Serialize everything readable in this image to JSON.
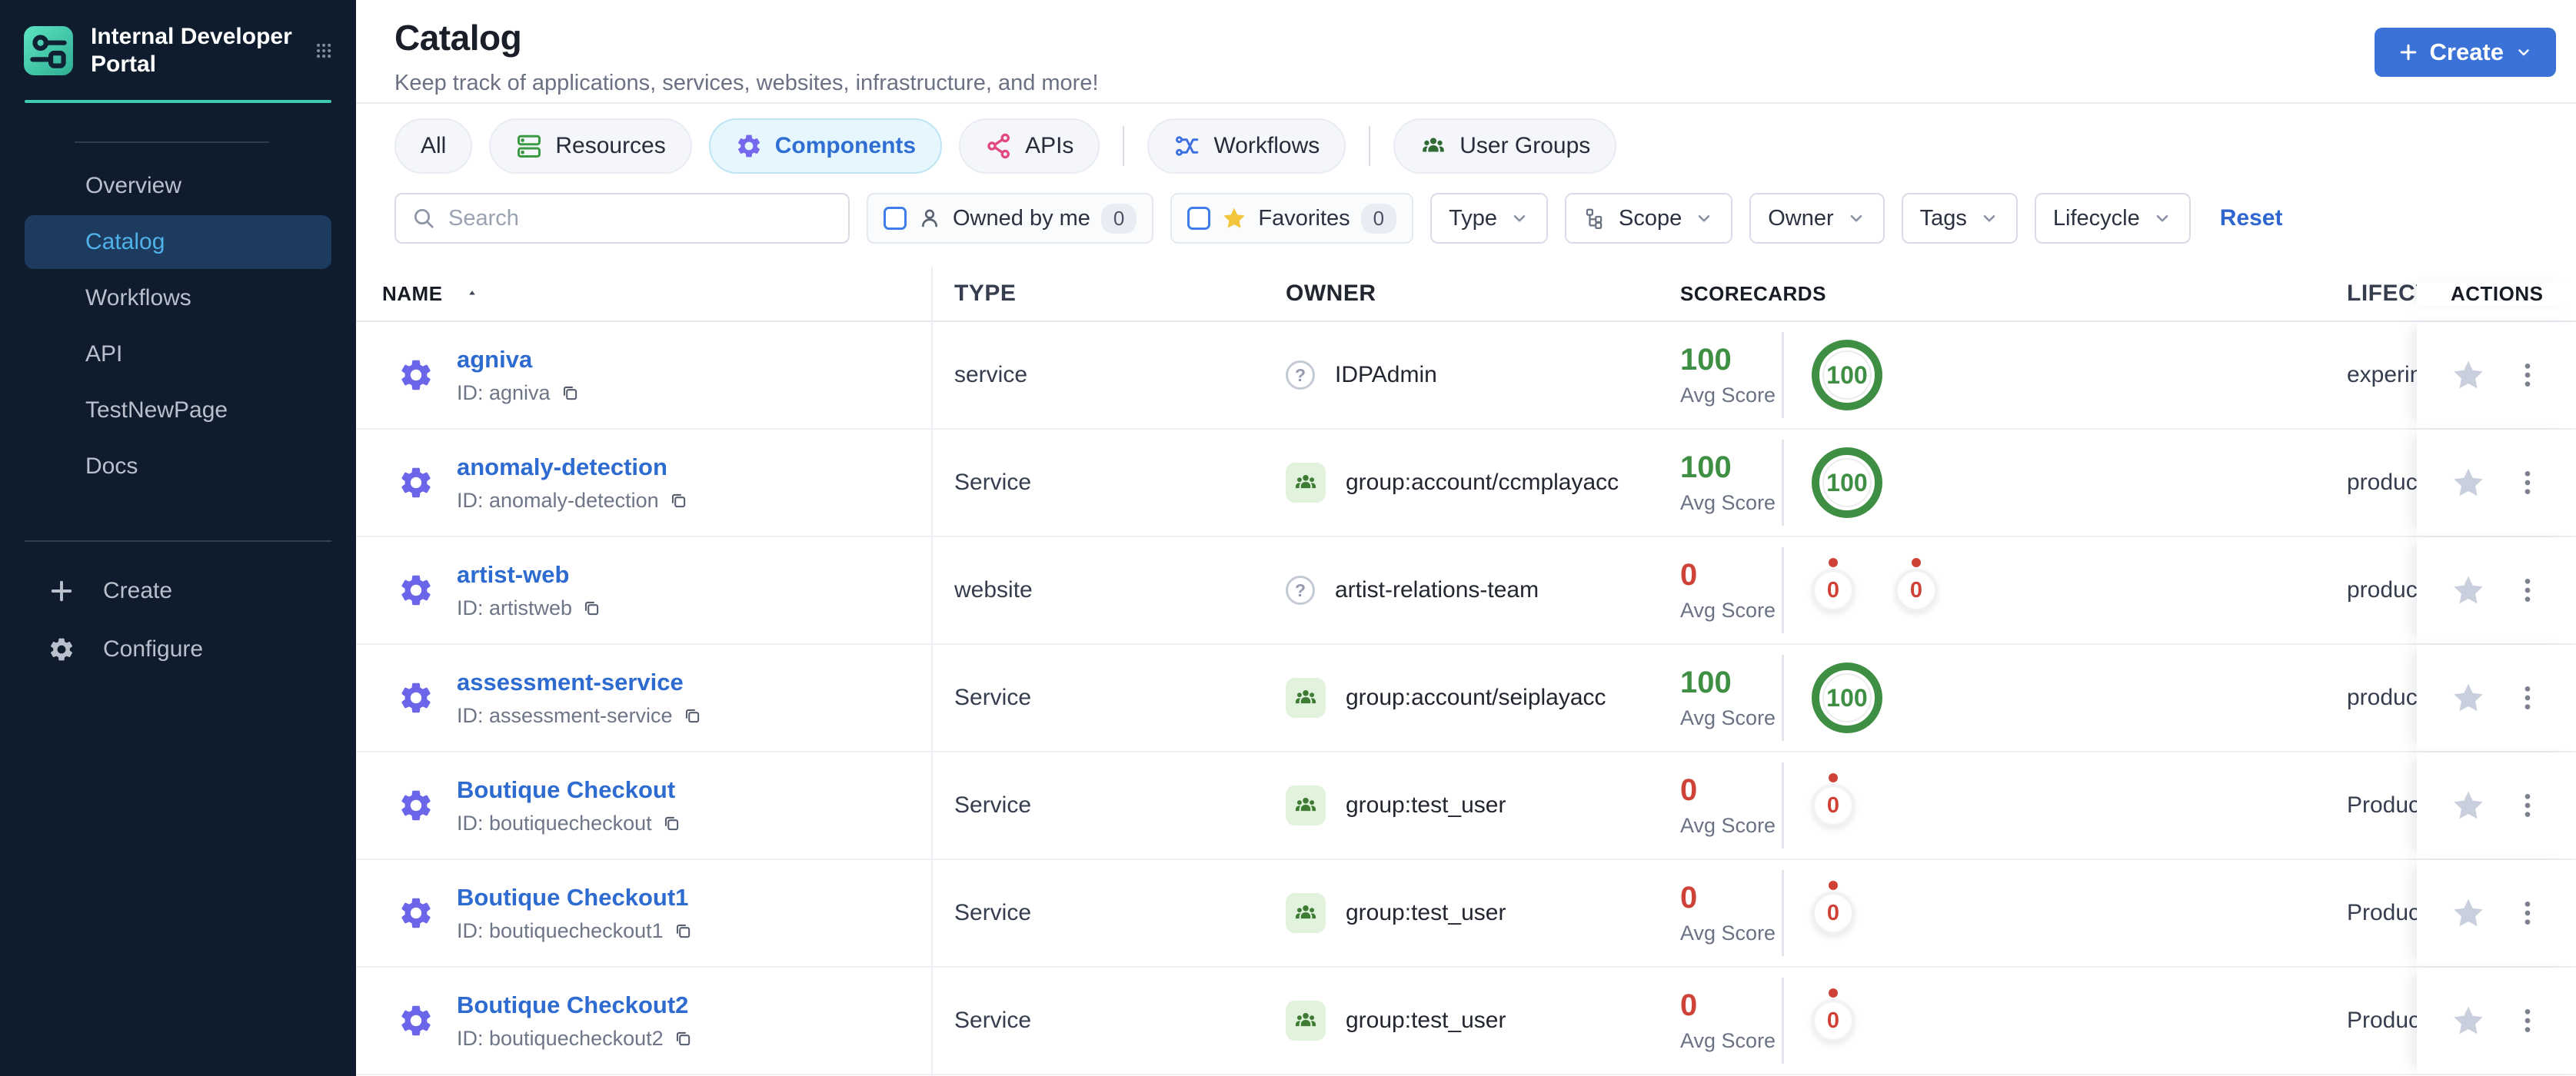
{
  "brand": {
    "title": "Internal Developer Portal",
    "logo_icon": "idp-logo",
    "grid_icon": "apps-grid-icon"
  },
  "sidebar": {
    "items": [
      {
        "label": "Overview",
        "active": false
      },
      {
        "label": "Catalog",
        "active": true
      },
      {
        "label": "Workflows",
        "active": false
      },
      {
        "label": "API",
        "active": false
      },
      {
        "label": "TestNewPage",
        "active": false
      },
      {
        "label": "Docs",
        "active": false
      }
    ],
    "footer": [
      {
        "label": "Create",
        "icon": "plus-icon"
      },
      {
        "label": "Configure",
        "icon": "gear-icon"
      }
    ]
  },
  "header": {
    "title": "Catalog",
    "subtitle": "Keep track of applications, services, websites, infrastructure, and more!",
    "create_label": "Create"
  },
  "tabs": [
    {
      "label": "All",
      "icon": null,
      "active": false
    },
    {
      "label": "Resources",
      "icon": "resources-stack-icon",
      "icon_color": "#3d9a44",
      "active": false
    },
    {
      "label": "Components",
      "icon": "gear-icon",
      "icon_color": "#7668ee",
      "active": true
    },
    {
      "label": "APIs",
      "icon": "share-nodes-icon",
      "icon_color": "#e1487e",
      "active": false
    },
    {
      "label": "Workflows",
      "icon": "shuffle-flow-icon",
      "icon_color": "#3e6fe0",
      "active": false
    },
    {
      "label": "User Groups",
      "icon": "people-icon",
      "icon_color": "#2f6b33",
      "active": false
    }
  ],
  "filters": {
    "search_placeholder": "Search",
    "owned_by_me": {
      "label": "Owned by me",
      "count": "0",
      "checked": false
    },
    "favorites": {
      "label": "Favorites",
      "count": "0",
      "checked": false
    },
    "dropdowns": [
      "Type",
      "Scope",
      "Owner",
      "Tags",
      "Lifecycle"
    ],
    "reset_label": "Reset"
  },
  "table": {
    "columns": [
      "NAME",
      "TYPE",
      "OWNER",
      "SCORECARDS",
      "LIFECYC",
      "ACTIONS"
    ],
    "avg_score_label": "Avg Score",
    "rows": [
      {
        "name": "agniva",
        "id": "ID: agniva",
        "type": "service",
        "owner": "IDPAdmin",
        "owner_icon": "unknown",
        "avg_score": "100",
        "score_variant": "green",
        "badges": [
          {
            "value": "100",
            "variant": "green"
          }
        ],
        "lifecycle": "experim"
      },
      {
        "name": "anomaly-detection",
        "id": "ID: anomaly-detection",
        "type": "Service",
        "owner": "group:account/ccmplayacc",
        "owner_icon": "group",
        "avg_score": "100",
        "score_variant": "green",
        "badges": [
          {
            "value": "100",
            "variant": "green"
          }
        ],
        "lifecycle": "produc"
      },
      {
        "name": "artist-web",
        "id": "ID: artistweb",
        "type": "website",
        "owner": "artist-relations-team",
        "owner_icon": "unknown",
        "avg_score": "0",
        "score_variant": "red",
        "badges": [
          {
            "value": "0",
            "variant": "red"
          },
          {
            "value": "0",
            "variant": "red"
          }
        ],
        "lifecycle": "produc"
      },
      {
        "name": "assessment-service",
        "id": "ID: assessment-service",
        "type": "Service",
        "owner": "group:account/seiplayacc",
        "owner_icon": "group",
        "avg_score": "100",
        "score_variant": "green",
        "badges": [
          {
            "value": "100",
            "variant": "green"
          }
        ],
        "lifecycle": "produc"
      },
      {
        "name": "Boutique Checkout",
        "id": "ID: boutiquecheckout",
        "type": "Service",
        "owner": "group:test_user",
        "owner_icon": "group",
        "avg_score": "0",
        "score_variant": "red",
        "badges": [
          {
            "value": "0",
            "variant": "red"
          }
        ],
        "lifecycle": "Produc"
      },
      {
        "name": "Boutique Checkout1",
        "id": "ID: boutiquecheckout1",
        "type": "Service",
        "owner": "group:test_user",
        "owner_icon": "group",
        "avg_score": "0",
        "score_variant": "red",
        "badges": [
          {
            "value": "0",
            "variant": "red"
          }
        ],
        "lifecycle": "Produc"
      },
      {
        "name": "Boutique Checkout2",
        "id": "ID: boutiquecheckout2",
        "type": "Service",
        "owner": "group:test_user",
        "owner_icon": "group",
        "avg_score": "0",
        "score_variant": "red",
        "badges": [
          {
            "value": "0",
            "variant": "red"
          }
        ],
        "lifecycle": "Produc"
      }
    ]
  },
  "icons": {
    "unknown_owner_glyph": "?"
  },
  "colors": {
    "sidebar_bg": "#0e1c2e",
    "accent_teal": "#3fc9ad",
    "active_item_text": "#4fb2e8",
    "active_item_bg": "#1d3b5f",
    "primary_button_blue": "#3b72d7",
    "link_blue": "#2e6bd0",
    "score_green": "#3e8e43",
    "score_red": "#ce4237",
    "active_tab_bg": "#e6f6fd",
    "active_tab_text": "#2f6fd3",
    "checkbox_blue": "#3f7de8"
  }
}
